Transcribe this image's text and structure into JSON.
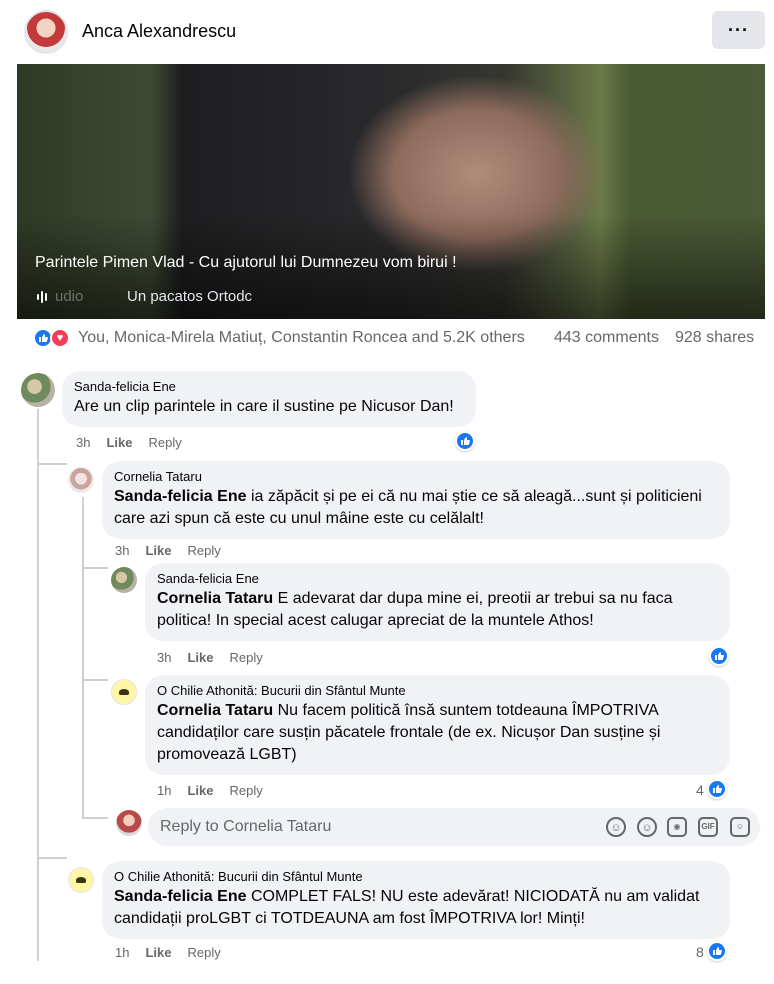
{
  "header": {
    "page_name": "Anca Alexandrescu",
    "more_button": "···"
  },
  "video": {
    "caption": "Parintele Pimen Vlad - Cu ajutorul lui Dumnezeu vom birui !",
    "audio_label": "udio",
    "channel": "Un pacatos Ortodc"
  },
  "post_stats": {
    "reactions_text": "You, Monica-Mirela Matiuț, Constantin Roncea and 5.2K others",
    "comments": "443 comments",
    "shares": "928 shares",
    "react_icons": [
      "like-icon",
      "love-icon"
    ]
  },
  "comments": [
    {
      "author": "Sanda-felicia Ene",
      "mention": "",
      "text": "Are un clip parintele in care il sustine pe Nicusor Dan!",
      "time": "3h",
      "like": "Like",
      "reply": "Reply",
      "count": ""
    },
    {
      "author": "Cornelia Tataru",
      "mention": "Sanda-felicia Ene",
      "text_line1": " ia zăpăcit și pe ei că nu mai știe ce să aleagă...sunt și politicieni",
      "text_line2": "care azi spun că este cu unul mâine este cu celălalt!",
      "time": "3h",
      "like": "Like",
      "reply": "Reply",
      "count": ""
    },
    {
      "author": "Sanda-felicia Ene",
      "mention": "Cornelia Tataru",
      "text_line1": " E adevarat dar dupa mine ei, preotii ar trebui sa nu faca",
      "text_line2": "politica! In special acest calugar apreciat de la muntele Athos!",
      "time": "3h",
      "like": "Like",
      "reply": "Reply",
      "count": ""
    },
    {
      "author": "O Chilie Athonită: Bucurii din Sfântul Munte",
      "mention": "Cornelia Tataru",
      "text_line1": " Nu facem politică însă suntem totdeauna ÎMPOTRIVA",
      "text_line2": "candidaților care susțin păcatele frontale (de ex. Nicușor Dan susține și",
      "text_line3": "promovează LGBT)",
      "time": "1h",
      "like": "Like",
      "reply": "Reply",
      "count": "4"
    },
    {
      "author": "O Chilie Athonită: Bucurii din Sfântul Munte",
      "mention": "Sanda-felicia Ene",
      "text_line1": " COMPLET FALS! NU este adevărat! NICIODATĂ nu am validat",
      "text_line2": "candidații proLGBT ci TOTDEAUNA am fost ÎMPOTRIVA lor! Minți!",
      "time": "1h",
      "like": "Like",
      "reply": "Reply",
      "count": "8"
    }
  ],
  "reply_box": {
    "placeholder": "Reply to Cornelia Tataru",
    "icons": [
      "avatar-sticker-icon",
      "emoji-icon",
      "camera-icon",
      "gif-icon",
      "sticker-icon"
    ]
  }
}
